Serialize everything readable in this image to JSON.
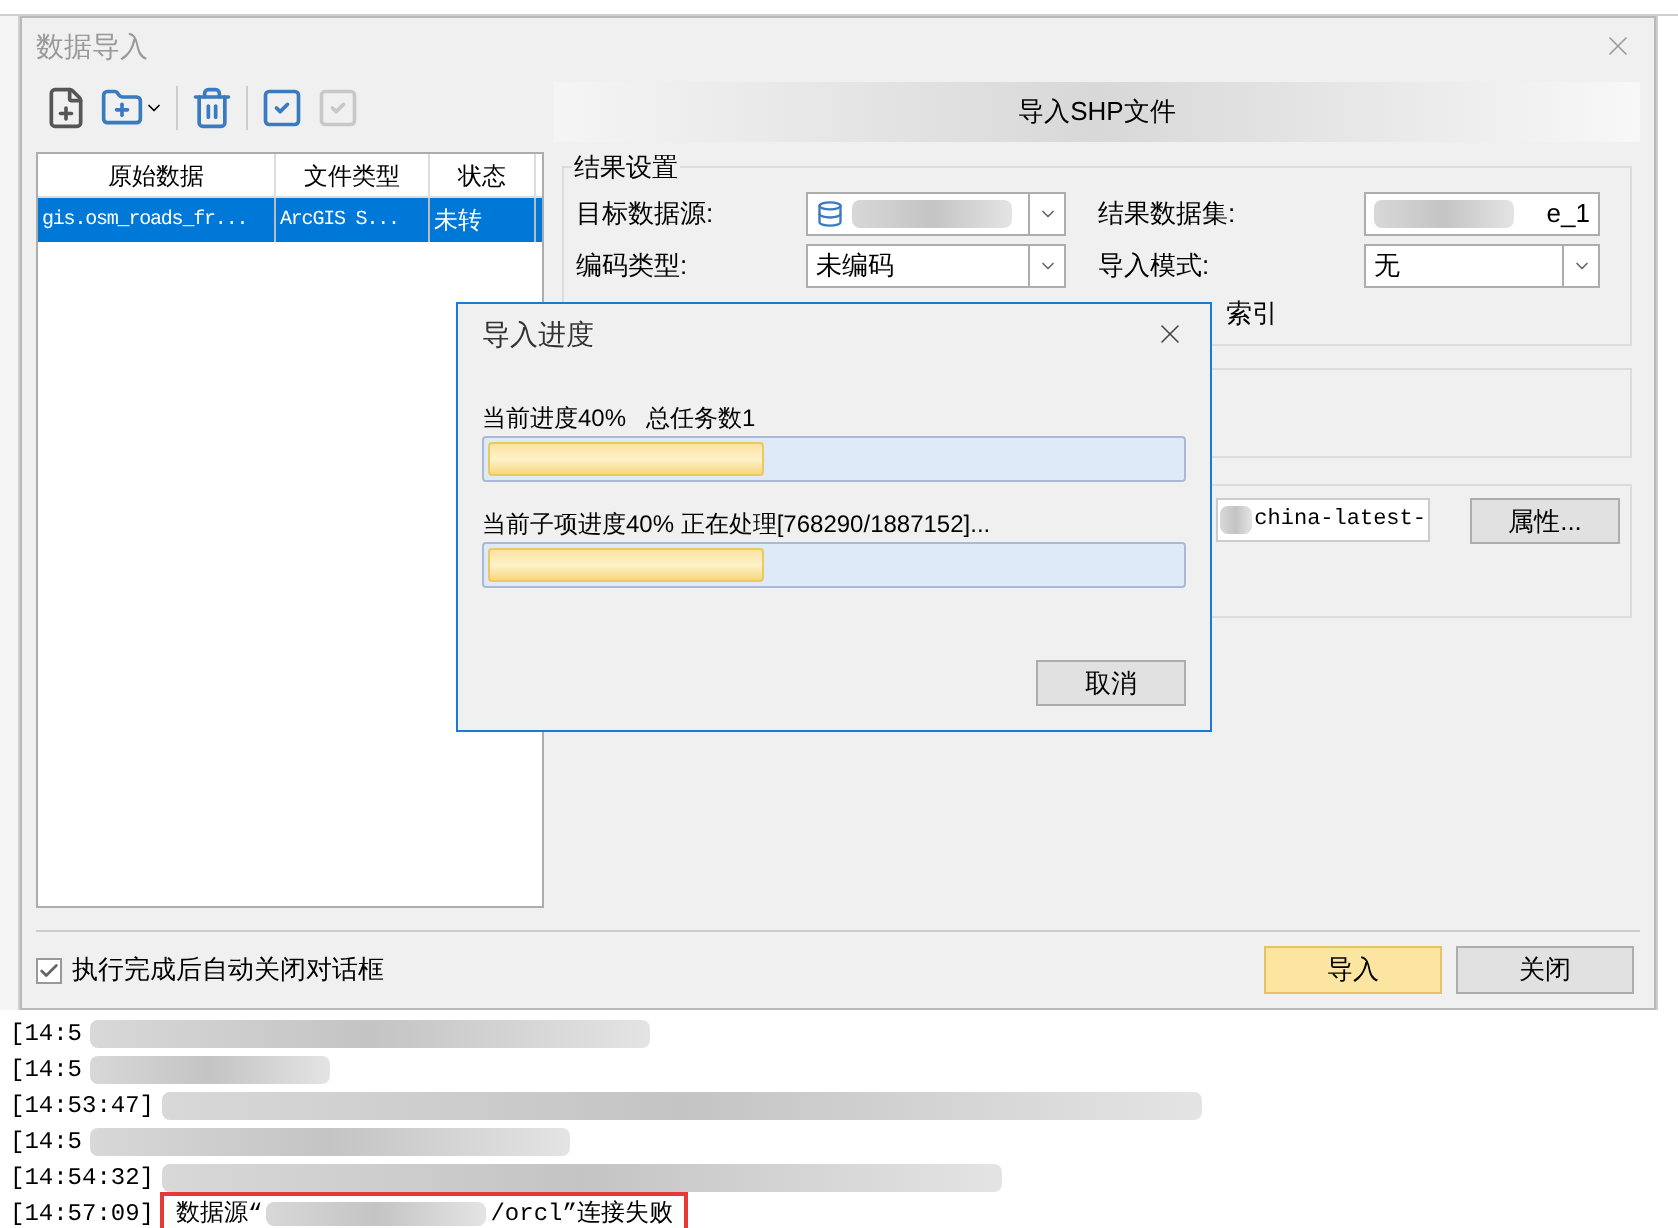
{
  "window": {
    "title": "数据导入"
  },
  "toolbar": [
    {
      "kind": "add-file",
      "disabled": false
    },
    {
      "kind": "add-folder",
      "disabled": false
    },
    {
      "kind": "delete",
      "disabled": false
    },
    {
      "kind": "check-all",
      "disabled": false
    },
    {
      "kind": "uncheck-all",
      "disabled": true
    }
  ],
  "file_list": {
    "columns": [
      "原始数据",
      "文件类型",
      "状态"
    ],
    "rows": [
      {
        "cells": [
          "gis.osm_roads_fr...",
          "ArcGIS S...",
          "未转"
        ],
        "selected": true
      }
    ]
  },
  "panel": {
    "title": "导入SHP文件",
    "group_title": "结果设置",
    "target_datasource": {
      "label": "目标数据源:"
    },
    "result_dataset": {
      "label": "结果数据集:",
      "value": "e_1"
    },
    "encoding": {
      "label": "编码类型:",
      "value": "未编码"
    },
    "import_mode": {
      "label": "导入模式:",
      "value": "无"
    },
    "index_text": "索引",
    "source_path": "china-latest-",
    "properties_button": "属性..."
  },
  "auto_close": {
    "label": "执行完成后自动关闭对话框",
    "checked": true
  },
  "buttons": [
    {
      "label": "导入",
      "kind": "primary"
    },
    {
      "label": "关闭",
      "kind": "normal"
    }
  ],
  "progress_dialog": {
    "title": "导入进度",
    "bars": [
      {
        "label": "当前进度40%   总任务数1",
        "level": 0.4
      },
      {
        "label": "当前子项进度40% 正在处理[768290/1887152]...",
        "level": 0.4
      }
    ],
    "cancel": "取消"
  },
  "log": [
    {
      "time": "[14:5",
      "highlighted": false
    },
    {
      "time": "[14:5",
      "highlighted": false
    },
    {
      "time": "[14:53:47]",
      "highlighted": false
    },
    {
      "time": "[14:5",
      "highlighted": false
    },
    {
      "time": "[14:54:32]",
      "highlighted": false
    },
    {
      "time": "[14:57:09]",
      "parts": [
        "数据源“",
        "/orcl”连接失败"
      ],
      "highlighted": true
    }
  ]
}
